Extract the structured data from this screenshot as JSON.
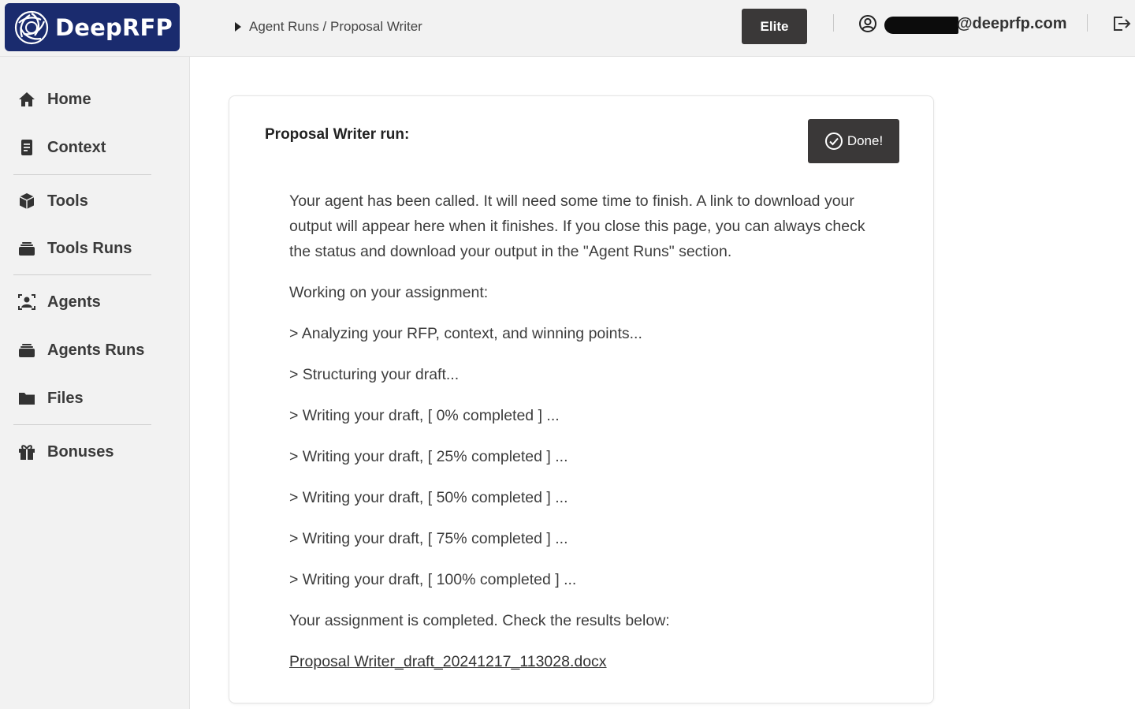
{
  "header": {
    "logo_text": "DeepRFP",
    "breadcrumb": "Agent Runs / Proposal Writer",
    "plan_badge": "Elite",
    "user_email": "@deeprfp.com"
  },
  "sidebar": {
    "items": [
      {
        "label": "Home",
        "icon": "home-icon"
      },
      {
        "label": "Context",
        "icon": "document-icon"
      },
      {
        "label": "Tools",
        "icon": "cube-icon"
      },
      {
        "label": "Tools Runs",
        "icon": "archive-icon"
      },
      {
        "label": "Agents",
        "icon": "agent-portrait-icon"
      },
      {
        "label": "Agents Runs",
        "icon": "archive-icon"
      },
      {
        "label": "Files",
        "icon": "folder-icon"
      },
      {
        "label": "Bonuses",
        "icon": "gift-icon"
      }
    ]
  },
  "card": {
    "title": "Proposal Writer run:",
    "done_label": "Done!",
    "intro": "Your agent has been called. It will need some time to finish. A link to download your output will appear here when it finishes. If you close this page, you can always check the status and download your output in the \"Agent Runs\" section.",
    "working": "Working on your assignment:",
    "steps": [
      "> Analyzing your RFP, context, and winning points...",
      "> Structuring your draft...",
      "> Writing your draft, [ 0% completed ] ...",
      "> Writing your draft, [ 25% completed ] ...",
      "> Writing your draft, [ 50% completed ] ...",
      "> Writing your draft, [ 75% completed ] ...",
      "> Writing your draft, [ 100% completed ] ..."
    ],
    "completed": "Your assignment is completed. Check the results below:",
    "result_file": "Proposal Writer_draft_20241217_113028.docx"
  },
  "colors": {
    "brand": "#1a2b6e",
    "dark_button": "#3a3838",
    "panel_bg": "#f2f2f2"
  }
}
